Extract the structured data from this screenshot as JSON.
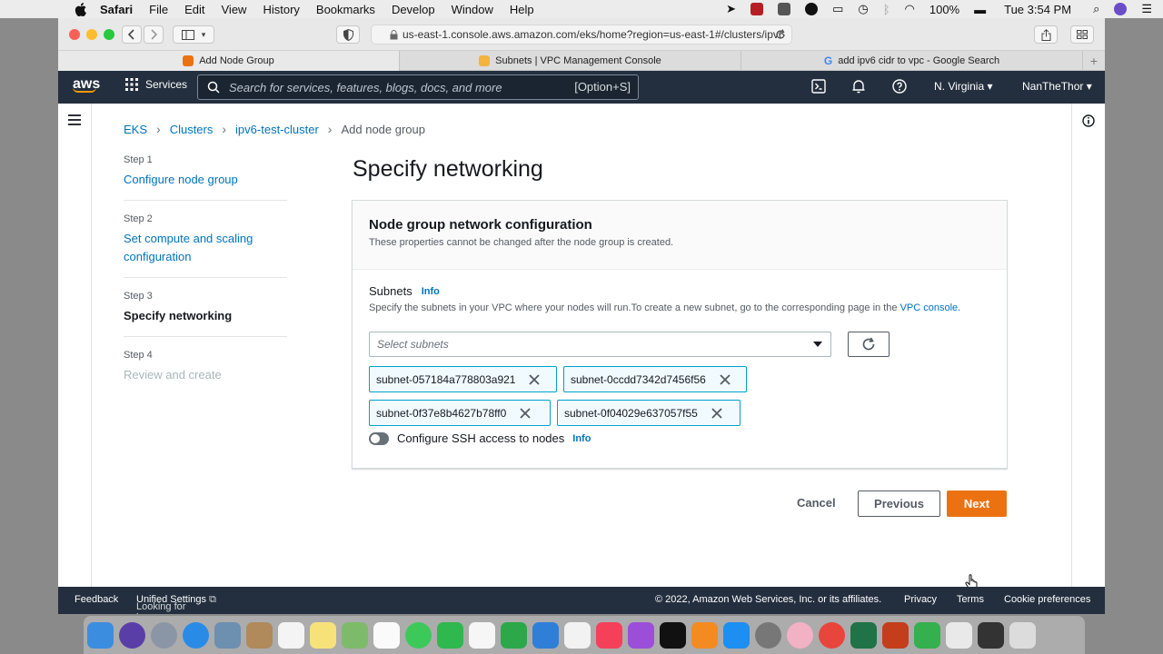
{
  "menubar": {
    "app": "Safari",
    "items": [
      "File",
      "Edit",
      "View",
      "History",
      "Bookmarks",
      "Develop",
      "Window",
      "Help"
    ],
    "battery": "100%",
    "clock": "Tue 3:54 PM"
  },
  "browser": {
    "url": "us-east-1.console.aws.amazon.com/eks/home?region=us-east-1#/clusters/ipv6",
    "tabs": [
      {
        "label": "Add Node Group",
        "active": true,
        "icon_color": "#ec7211"
      },
      {
        "label": "Subnets | VPC Management Console",
        "active": false,
        "icon_color": "#f3b33d"
      },
      {
        "label": "add ipv6 cidr to vpc - Google Search",
        "active": false,
        "icon_color": "#4285f4"
      }
    ]
  },
  "aws_nav": {
    "logo": "aws",
    "services": "Services",
    "search_placeholder": "Search for services, features, blogs, docs, and more",
    "search_shortcut": "[Option+S]",
    "region": "N. Virginia",
    "user": "NanTheThor"
  },
  "breadcrumb": [
    "EKS",
    "Clusters",
    "ipv6-test-cluster",
    "Add node group"
  ],
  "steps": [
    {
      "num": "Step 1",
      "title": "Configure node group",
      "state": "link"
    },
    {
      "num": "Step 2",
      "title": "Set compute and scaling configuration",
      "state": "link"
    },
    {
      "num": "Step 3",
      "title": "Specify networking",
      "state": "current"
    },
    {
      "num": "Step 4",
      "title": "Review and create",
      "state": "disabled"
    }
  ],
  "page_title": "Specify networking",
  "card": {
    "title": "Node group network configuration",
    "subtitle": "These properties cannot be changed after the node group is created.",
    "subnets_label": "Subnets",
    "info": "Info",
    "subnets_desc": "Specify the subnets in your VPC where your nodes will run.To create a new subnet, go to the corresponding page in the",
    "subnets_desc_link": "VPC console.",
    "select_placeholder": "Select subnets",
    "tokens": [
      "subnet-057184a778803a921",
      "subnet-0ccdd7342d7456f56",
      "subnet-0f37e8b4627b78ff0",
      "subnet-0f04029e637057f55"
    ],
    "ssh_label": "Configure SSH access to nodes",
    "ssh_info": "Info",
    "ssh_enabled": false
  },
  "actions": {
    "cancel": "Cancel",
    "previous": "Previous",
    "next": "Next"
  },
  "footer": {
    "feedback": "Feedback",
    "language_text": "Looking for language selection? Find it in the new",
    "unified": "Unified Settings",
    "copyright": "© 2022, Amazon Web Services, Inc. or its affiliates.",
    "privacy": "Privacy",
    "terms": "Terms",
    "cookies": "Cookie preferences"
  }
}
